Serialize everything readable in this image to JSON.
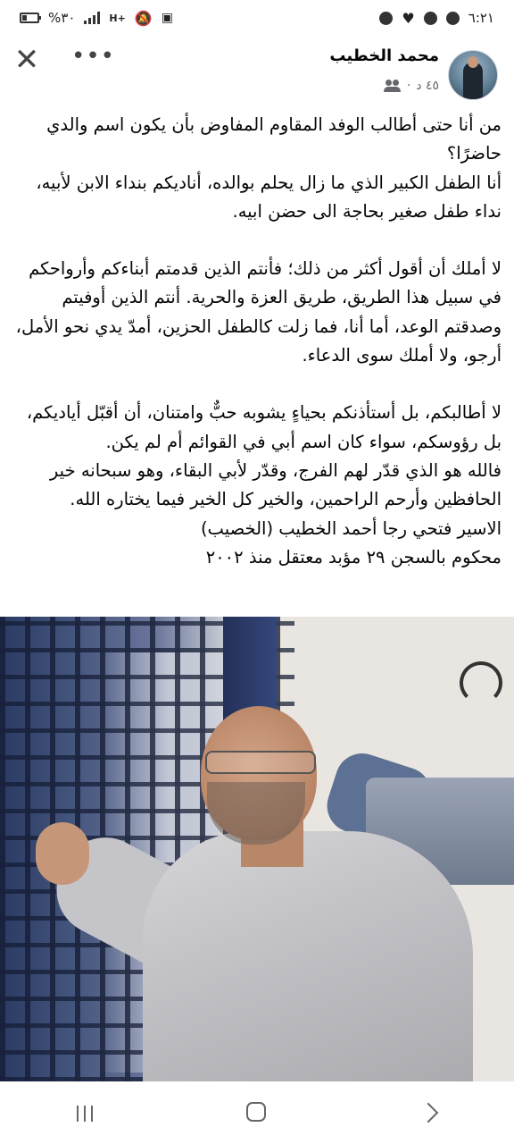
{
  "status_bar": {
    "time": "٦:٢١",
    "battery_text": "%٣٠",
    "network_text": "H+",
    "battery_level_percent": 30
  },
  "post": {
    "author": "محمد الخطيب",
    "time_ago": "٤٥ د",
    "separator": "·",
    "paragraphs": [
      "من أنا حتى أطالب الوفد المقاوم المفاوض بأن يكون اسم والدي حاضرًا؟",
      "أنا الطفل الكبير الذي ما زال يحلم بوالده، أناديكم بنداء الابن لأبيه، نداء طفل صغير بحاجة الى حضن ابيه.",
      "لا أملك أن أقول أكثر من ذلك؛ فأنتم الذين قدمتم أبناءكم وأرواحكم في سبيل هذا الطريق، طريق العزة والحرية. أنتم الذين أوفيتم وصدقتم الوعد، أما أنا، فما زلت كالطفل الحزين، أمدّ يدي نحو الأمل، أرجو، ولا أملك سوى الدعاء.",
      "لا أطالبكم، بل أستأذنكم بحياءٍ يشوبه حبٌّ وامتنان، أن أقبّل أياديكم، بل رؤوسكم، سواء كان اسم أبي في القوائم أم لم يكن.",
      "فالله هو الذي قدّر لهم الفرج، وقدّر لأبي البقاء، وهو سبحانه خير الحافظين وأرحم الراحمين، والخير كل الخير فيما يختاره الله.",
      "الاسير فتحي رجا أحمد الخطيب (الخصيب)",
      "محكوم بالسجن ٢٩ مؤبد معتقل منذ ٢٠٠٢"
    ]
  },
  "icons": {
    "close": "close-icon",
    "more": "more-icon",
    "audience": "friends-icon"
  },
  "nav": {
    "recent": "recent-apps-icon",
    "home": "home-icon",
    "back": "back-icon"
  }
}
